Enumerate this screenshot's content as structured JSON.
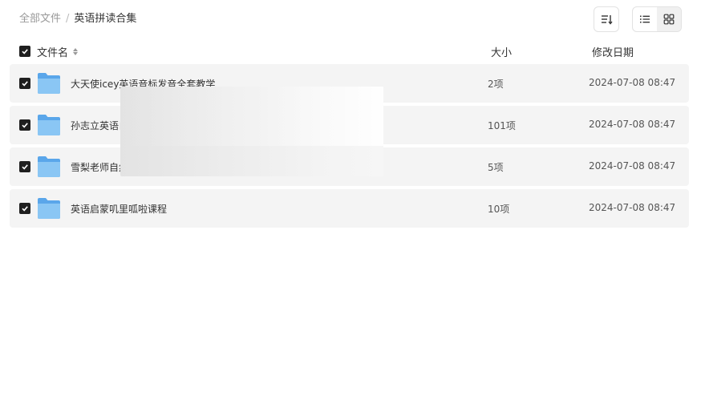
{
  "breadcrumb": {
    "root": "全部文件",
    "separator": "/",
    "current": "英语拼读合集"
  },
  "toolbar": {
    "sort_icon": "sort-icon",
    "list_view_icon": "list-view-icon",
    "grid_view_icon": "grid-view-icon",
    "active_view": "list"
  },
  "header": {
    "name": "文件名",
    "size": "大小",
    "date": "修改日期",
    "all_checked": true
  },
  "files": [
    {
      "name": "大天使icey英语音标发音全套教学",
      "size": "2项",
      "date": "2024-07-08 08:47",
      "checked": true,
      "icon": "folder-icon"
    },
    {
      "name": "孙志立英语自然拼读",
      "size": "101项",
      "date": "2024-07-08 08:47",
      "checked": true,
      "icon": "folder-icon"
    },
    {
      "name": "雪梨老师自然拼读",
      "size": "5项",
      "date": "2024-07-08 08:47",
      "checked": true,
      "icon": "folder-icon"
    },
    {
      "name": "英语启蒙叽里呱啦课程",
      "size": "10项",
      "date": "2024-07-08 08:47",
      "checked": true,
      "icon": "folder-icon"
    }
  ],
  "colors": {
    "row_bg": "#f4f4f4",
    "checkbox": "#1f1f1f",
    "folder_blue": "#7cbcf0"
  }
}
